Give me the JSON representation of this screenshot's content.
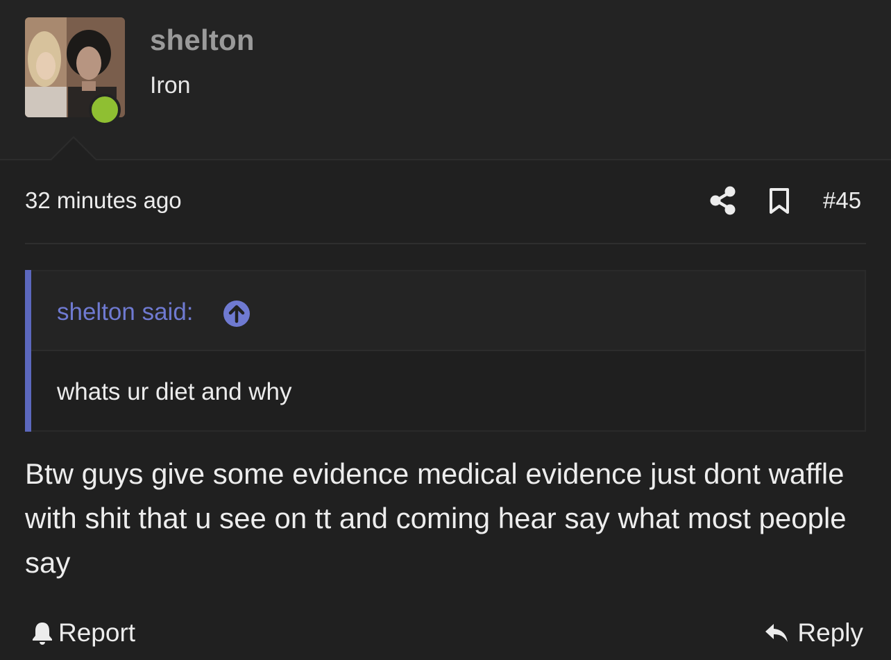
{
  "user": {
    "name": "shelton",
    "title": "Iron",
    "online": true
  },
  "post": {
    "time": "32 minutes ago",
    "number": "#45",
    "body": "Btw guys give some evidence medical evidence just dont waffle with shit that u see on tt and coming hear say what most people say"
  },
  "quote": {
    "author": "shelton said:",
    "text": "whats ur diet and why"
  },
  "actions": {
    "report_label": "Report",
    "reply_label": "Reply"
  },
  "icons": {
    "share": "share-icon",
    "bookmark": "bookmark-icon",
    "quote_jump": "arrow-up-circle-icon",
    "report": "bell-icon",
    "reply": "reply-arrow-icon"
  },
  "colors": {
    "background": "#202020",
    "accent": "#5c68bd",
    "quote_author": "#6f7ad1",
    "online": "#8fbf32",
    "username": "#9a9a9a"
  }
}
